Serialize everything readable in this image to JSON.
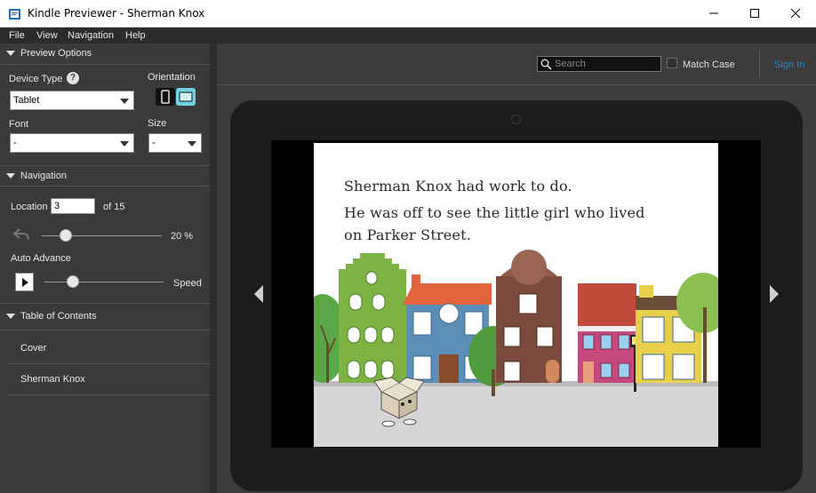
{
  "window": {
    "title": "Kindle Previewer - Sherman Knox"
  },
  "menu": {
    "file": "File",
    "view": "View",
    "navigation": "Navigation",
    "help": "Help"
  },
  "sidebar": {
    "preview_options": {
      "header": "Preview Options",
      "device_type_label": "Device Type",
      "device_type_value": "Tablet",
      "orientation_label": "Orientation",
      "font_label": "Font",
      "font_value": "-",
      "size_label": "Size",
      "size_value": "-"
    },
    "navigation": {
      "header": "Navigation",
      "location_label": "Location",
      "location_value": "3",
      "location_total": "of 15",
      "progress_percent": "20 %",
      "progress_fraction": 0.2,
      "auto_advance_label": "Auto Advance",
      "speed_label": "Speed"
    },
    "toc": {
      "header": "Table of Contents",
      "items": [
        "Cover",
        "Sherman Knox"
      ]
    }
  },
  "toolbar": {
    "search_placeholder": "Search",
    "match_case_label": "Match Case",
    "sign_in": "Sign In"
  },
  "book": {
    "lines": [
      "Sherman Knox had work to do.",
      "He was off to see the little girl who lived",
      "on Parker Street."
    ]
  },
  "colors": {
    "accent": "#1a8fd6",
    "orientation_active": "#6dd3e0"
  }
}
